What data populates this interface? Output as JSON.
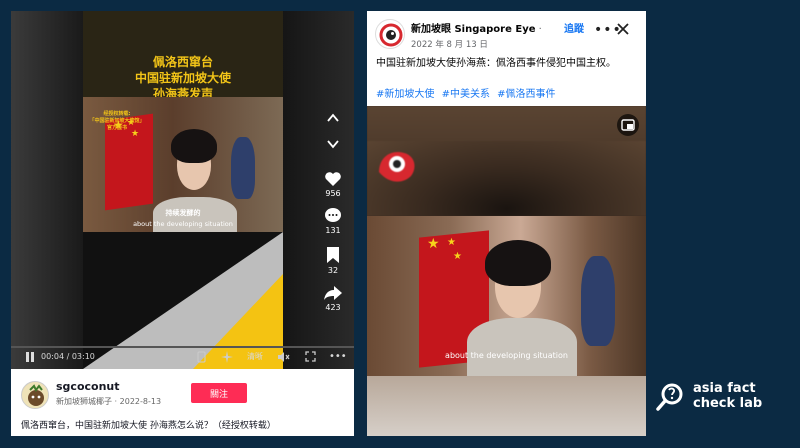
{
  "left_video": {
    "headline": [
      "佩洛西窜台",
      "中国驻新加坡大使",
      "孙海燕发声"
    ],
    "badge": "经授权转载:\n「中国驻新加坡大使馆」\n官方脸书",
    "subtitle_cn": "持续发酵的",
    "subtitle_en": "about the developing situation",
    "rail": {
      "likes": "956",
      "comments": "131",
      "saves": "32",
      "shares": "423"
    },
    "controls": {
      "time": "00:04 / 03:10",
      "quality": "清晰"
    },
    "author": {
      "username": "sgcoconut",
      "display_name": "新加坡狮城椰子",
      "date": "2022-8-13",
      "follow_label": "關注"
    },
    "caption": "佩洛西窜台，中国驻新加坡大使 孙海燕怎么说？（经授权转载）"
  },
  "right_post": {
    "page_name": "新加坡眼 Singapore Eye",
    "separator": " · ",
    "follow_label": "追蹤",
    "date": "2022 年 8 月 13 日",
    "text": "中国驻新加坡大使孙海燕：佩洛西事件侵犯中国主权。",
    "hashtags": [
      "#新加坡大使",
      "#中美关系",
      "#佩洛西事件"
    ],
    "video_subtitle": "about the developing situation"
  },
  "watermark": {
    "line1": "asia fact",
    "line2": "check lab"
  },
  "colors": {
    "background": "#0b2a43",
    "follow_red": "#fe2c55",
    "fb_blue": "#1877f2",
    "headline_yellow": "#f2c418"
  }
}
